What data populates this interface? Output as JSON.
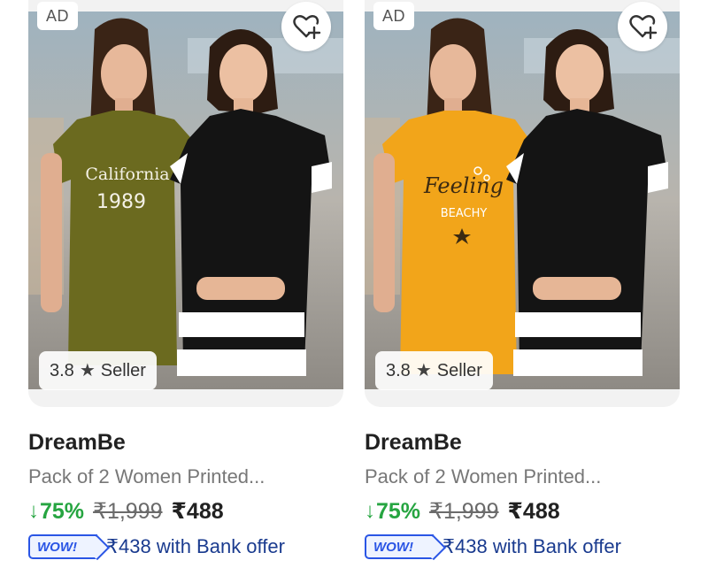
{
  "colors": {
    "discount_green": "#26a541",
    "offer_blue": "#1a3b8f",
    "wow_blue": "#2a55e5"
  },
  "products": [
    {
      "ad_label": "AD",
      "wishlist_icon": "heart-plus-icon",
      "rating": "3.8",
      "rating_icon": "star-icon",
      "rating_label": "Seller",
      "shirt_print_line1": "California",
      "shirt_print_line2": "1989",
      "brand": "DreamBe",
      "title": "Pack of 2 Women Printed...",
      "discount": "75%",
      "mrp": "₹1,999",
      "price": "₹488",
      "offer_badge": "WOW!",
      "offer_text": "₹438 with Bank offer"
    },
    {
      "ad_label": "AD",
      "wishlist_icon": "heart-plus-icon",
      "rating": "3.8",
      "rating_icon": "star-icon",
      "rating_label": "Seller",
      "shirt_print_line1": "Feeling",
      "shirt_print_line2": "BEACHY",
      "brand": "DreamBe",
      "title": "Pack of 2 Women Printed...",
      "discount": "75%",
      "mrp": "₹1,999",
      "price": "₹488",
      "offer_badge": "WOW!",
      "offer_text": "₹438 with Bank offer"
    }
  ]
}
